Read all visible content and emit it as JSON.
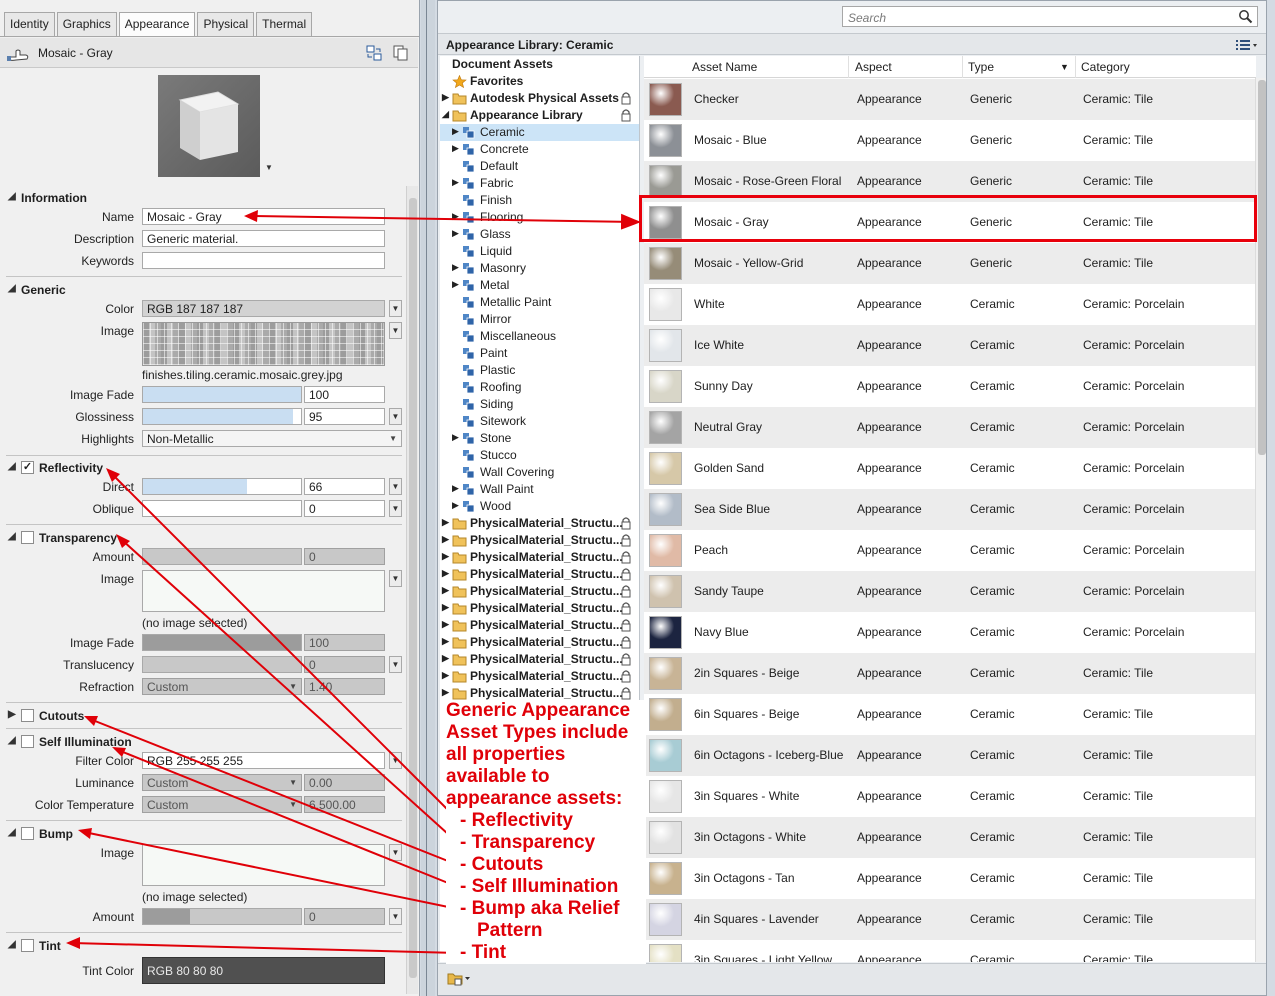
{
  "tabs": [
    "Identity",
    "Graphics",
    "Appearance",
    "Physical",
    "Thermal"
  ],
  "asset": {
    "name": "Mosaic - Gray"
  },
  "information": {
    "title": "Information",
    "name_label": "Name",
    "name_value": "Mosaic - Gray",
    "description_label": "Description",
    "description_value": "Generic material.",
    "keywords_label": "Keywords",
    "keywords_value": ""
  },
  "generic": {
    "title": "Generic",
    "color_label": "Color",
    "color_value": "RGB 187 187 187",
    "image_label": "Image",
    "image_file": "finishes.tiling.ceramic.mosaic.grey.jpg",
    "image_fade_label": "Image Fade",
    "image_fade_value": "100",
    "image_fade_level": 100,
    "glossiness_label": "Glossiness",
    "glossiness_value": "95",
    "glossiness_level": 95,
    "highlights_label": "Highlights",
    "highlights_value": "Non-Metallic"
  },
  "reflectivity": {
    "title": "Reflectivity",
    "checked": "✓",
    "direct_label": "Direct",
    "direct_value": "66",
    "direct_level": 66,
    "oblique_label": "Oblique",
    "oblique_value": "0",
    "oblique_level": 0
  },
  "transparency": {
    "title": "Transparency",
    "amount_label": "Amount",
    "amount_value": "0",
    "image_label": "Image",
    "image_note": "(no image selected)",
    "image_fade_label": "Image Fade",
    "image_fade_value": "100",
    "image_fade_level": 100,
    "translucency_label": "Translucency",
    "translucency_value": "0",
    "refraction_label": "Refraction",
    "refraction_option": "Custom",
    "refraction_value": "1.40"
  },
  "cutouts": {
    "title": "Cutouts"
  },
  "self_illumination": {
    "title": "Self Illumination",
    "filter_color_label": "Filter Color",
    "filter_color_value": "RGB 255 255 255",
    "luminance_label": "Luminance",
    "luminance_option": "Custom",
    "luminance_value": "0.00",
    "color_temp_label": "Color Temperature",
    "color_temp_option": "Custom",
    "color_temp_value": "6,500.00"
  },
  "bump": {
    "title": "Bump",
    "image_label": "Image",
    "image_note": "(no image selected)",
    "amount_label": "Amount",
    "amount_value": "0",
    "amount_level": 30
  },
  "tint": {
    "title": "Tint",
    "tint_color_label": "Tint Color",
    "tint_color_value": "RGB 80 80 80"
  },
  "search": {
    "placeholder": "Search"
  },
  "library": {
    "title": "Appearance Library: Ceramic"
  },
  "tree": [
    {
      "label": "Document Assets",
      "level": 0,
      "bold": true,
      "icon": "none",
      "expander": ""
    },
    {
      "label": "Favorites",
      "level": 0,
      "bold": true,
      "icon": "star-icon",
      "expander": ""
    },
    {
      "label": "Autodesk Physical Assets",
      "level": 0,
      "bold": true,
      "icon": "folder-icon",
      "expander": "▶",
      "lock": true
    },
    {
      "label": "Appearance Library",
      "level": 0,
      "bold": true,
      "icon": "folder-icon",
      "expander": "◢",
      "lock": true
    },
    {
      "label": "Ceramic",
      "level": 1,
      "icon": "library-icon",
      "expander": "▶",
      "selected": true
    },
    {
      "label": "Concrete",
      "level": 1,
      "icon": "library-icon",
      "expander": "▶"
    },
    {
      "label": "Default",
      "level": 1,
      "icon": "library-icon",
      "expander": ""
    },
    {
      "label": "Fabric",
      "level": 1,
      "icon": "library-icon",
      "expander": "▶"
    },
    {
      "label": "Finish",
      "level": 1,
      "icon": "library-icon",
      "expander": ""
    },
    {
      "label": "Flooring",
      "level": 1,
      "icon": "library-icon",
      "expander": "▶"
    },
    {
      "label": "Glass",
      "level": 1,
      "icon": "library-icon",
      "expander": "▶"
    },
    {
      "label": "Liquid",
      "level": 1,
      "icon": "library-icon",
      "expander": ""
    },
    {
      "label": "Masonry",
      "level": 1,
      "icon": "library-icon",
      "expander": "▶"
    },
    {
      "label": "Metal",
      "level": 1,
      "icon": "library-icon",
      "expander": "▶"
    },
    {
      "label": "Metallic Paint",
      "level": 1,
      "icon": "library-icon",
      "expander": ""
    },
    {
      "label": "Mirror",
      "level": 1,
      "icon": "library-icon",
      "expander": ""
    },
    {
      "label": "Miscellaneous",
      "level": 1,
      "icon": "library-icon",
      "expander": ""
    },
    {
      "label": "Paint",
      "level": 1,
      "icon": "library-icon",
      "expander": ""
    },
    {
      "label": "Plastic",
      "level": 1,
      "icon": "library-icon",
      "expander": ""
    },
    {
      "label": "Roofing",
      "level": 1,
      "icon": "library-icon",
      "expander": ""
    },
    {
      "label": "Siding",
      "level": 1,
      "icon": "library-icon",
      "expander": ""
    },
    {
      "label": "Sitework",
      "level": 1,
      "icon": "library-icon",
      "expander": ""
    },
    {
      "label": "Stone",
      "level": 1,
      "icon": "library-icon",
      "expander": "▶"
    },
    {
      "label": "Stucco",
      "level": 1,
      "icon": "library-icon",
      "expander": ""
    },
    {
      "label": "Wall Covering",
      "level": 1,
      "icon": "library-icon",
      "expander": ""
    },
    {
      "label": "Wall Paint",
      "level": 1,
      "icon": "library-icon",
      "expander": "▶"
    },
    {
      "label": "Wood",
      "level": 1,
      "icon": "library-icon",
      "expander": "▶"
    },
    {
      "label": "PhysicalMaterial_Structu...",
      "level": 0,
      "bold": true,
      "icon": "folder-icon",
      "expander": "▶",
      "lock": true
    },
    {
      "label": "PhysicalMaterial_Structu...",
      "level": 0,
      "bold": true,
      "icon": "folder-icon",
      "expander": "▶",
      "lock": true
    },
    {
      "label": "PhysicalMaterial_Structu...",
      "level": 0,
      "bold": true,
      "icon": "folder-icon",
      "expander": "▶",
      "lock": true
    },
    {
      "label": "PhysicalMaterial_Structu...",
      "level": 0,
      "bold": true,
      "icon": "folder-icon",
      "expander": "▶",
      "lock": true
    },
    {
      "label": "PhysicalMaterial_Structu...",
      "level": 0,
      "bold": true,
      "icon": "folder-icon",
      "expander": "▶",
      "lock": true
    },
    {
      "label": "PhysicalMaterial_Structu...",
      "level": 0,
      "bold": true,
      "icon": "folder-icon",
      "expander": "▶",
      "lock": true
    },
    {
      "label": "PhysicalMaterial_Structu...",
      "level": 0,
      "bold": true,
      "icon": "folder-icon",
      "expander": "▶",
      "lock": true
    },
    {
      "label": "PhysicalMaterial_Structu...",
      "level": 0,
      "bold": true,
      "icon": "folder-icon",
      "expander": "▶",
      "lock": true
    },
    {
      "label": "PhysicalMaterial_Structu...",
      "level": 0,
      "bold": true,
      "icon": "folder-icon",
      "expander": "▶",
      "lock": true
    },
    {
      "label": "PhysicalMaterial_Structu...",
      "level": 0,
      "bold": true,
      "icon": "folder-icon",
      "expander": "▶",
      "lock": true
    },
    {
      "label": "PhysicalMaterial_Structu...",
      "level": 0,
      "bold": true,
      "icon": "folder-icon",
      "expander": "▶",
      "lock": true
    }
  ],
  "grid": {
    "columns": [
      "Asset Name",
      "Aspect",
      "Type",
      "Category"
    ],
    "rows": [
      {
        "name": "Checker",
        "aspect": "Appearance",
        "type": "Generic",
        "category": "Ceramic: Tile",
        "swatch": "#8a5a50"
      },
      {
        "name": "Mosaic - Blue",
        "aspect": "Appearance",
        "type": "Generic",
        "category": "Ceramic: Tile",
        "swatch": "#8c9096"
      },
      {
        "name": "Mosaic - Rose-Green Floral",
        "aspect": "Appearance",
        "type": "Generic",
        "category": "Ceramic: Tile",
        "swatch": "#9a9a94"
      },
      {
        "name": "Mosaic - Gray",
        "aspect": "Appearance",
        "type": "Generic",
        "category": "Ceramic: Tile",
        "swatch": "#8f8f8f"
      },
      {
        "name": "Mosaic - Yellow-Grid",
        "aspect": "Appearance",
        "type": "Generic",
        "category": "Ceramic: Tile",
        "swatch": "#968c78"
      },
      {
        "name": "White",
        "aspect": "Appearance",
        "type": "Ceramic",
        "category": "Ceramic: Porcelain",
        "swatch": "#e8e8e8"
      },
      {
        "name": "Ice White",
        "aspect": "Appearance",
        "type": "Ceramic",
        "category": "Ceramic: Porcelain",
        "swatch": "#e2e6ea"
      },
      {
        "name": "Sunny Day",
        "aspect": "Appearance",
        "type": "Ceramic",
        "category": "Ceramic: Porcelain",
        "swatch": "#d8d6c8"
      },
      {
        "name": "Neutral Gray",
        "aspect": "Appearance",
        "type": "Ceramic",
        "category": "Ceramic: Porcelain",
        "swatch": "#a4a4a4"
      },
      {
        "name": "Golden Sand",
        "aspect": "Appearance",
        "type": "Ceramic",
        "category": "Ceramic: Porcelain",
        "swatch": "#d6c8a8"
      },
      {
        "name": "Sea Side Blue",
        "aspect": "Appearance",
        "type": "Ceramic",
        "category": "Ceramic: Porcelain",
        "swatch": "#b2bcc8"
      },
      {
        "name": "Peach",
        "aspect": "Appearance",
        "type": "Ceramic",
        "category": "Ceramic: Porcelain",
        "swatch": "#e0baa6"
      },
      {
        "name": "Sandy Taupe",
        "aspect": "Appearance",
        "type": "Ceramic",
        "category": "Ceramic: Porcelain",
        "swatch": "#cfc2ae"
      },
      {
        "name": "Navy Blue",
        "aspect": "Appearance",
        "type": "Ceramic",
        "category": "Ceramic: Porcelain",
        "swatch": "#1c2440"
      },
      {
        "name": "2in Squares - Beige",
        "aspect": "Appearance",
        "type": "Ceramic",
        "category": "Ceramic: Tile",
        "swatch": "#c8b496"
      },
      {
        "name": "6in Squares - Beige",
        "aspect": "Appearance",
        "type": "Ceramic",
        "category": "Ceramic: Tile",
        "swatch": "#c2ae8e"
      },
      {
        "name": "6in Octagons - Iceberg-Blue",
        "aspect": "Appearance",
        "type": "Ceramic",
        "category": "Ceramic: Tile",
        "swatch": "#a8ccd4"
      },
      {
        "name": "3in Squares - White",
        "aspect": "Appearance",
        "type": "Ceramic",
        "category": "Ceramic: Tile",
        "swatch": "#e6e6e6"
      },
      {
        "name": "3in Octagons - White",
        "aspect": "Appearance",
        "type": "Ceramic",
        "category": "Ceramic: Tile",
        "swatch": "#e2e2e2"
      },
      {
        "name": "3in Octagons - Tan",
        "aspect": "Appearance",
        "type": "Ceramic",
        "category": "Ceramic: Tile",
        "swatch": "#c8b28e"
      },
      {
        "name": "4in Squares - Lavender",
        "aspect": "Appearance",
        "type": "Ceramic",
        "category": "Ceramic: Tile",
        "swatch": "#d4d4e2"
      },
      {
        "name": "3in Squares - Light Yellow",
        "aspect": "Appearance",
        "type": "Ceramic",
        "category": "Ceramic: Tile",
        "swatch": "#e4e0c4"
      }
    ]
  },
  "annotation": {
    "intro_lines": [
      "Generic Appearance",
      "Asset Types include",
      "all properties",
      "available to",
      "appearance assets:"
    ],
    "items": [
      "Reflectivity",
      "Transparency",
      "Cutouts",
      "Self Illumination",
      "Bump aka Relief"
    ],
    "continuation": "Pattern",
    "last_item": "Tint",
    "color": "#e00008"
  }
}
